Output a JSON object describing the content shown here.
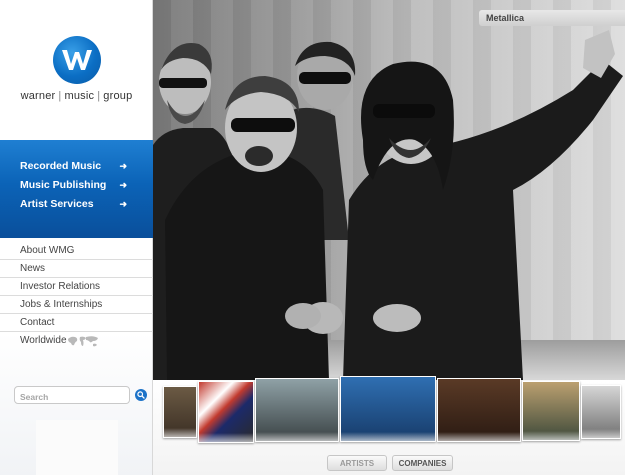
{
  "brand": {
    "words": [
      "warner",
      "music",
      "group"
    ],
    "color": "#0b6ec4"
  },
  "primary_nav": [
    {
      "label": "Recorded Music",
      "icon": "arrow-right-icon"
    },
    {
      "label": "Music Publishing",
      "icon": "arrow-right-icon"
    },
    {
      "label": "Artist Services",
      "icon": "arrow-right-icon"
    }
  ],
  "secondary_nav": [
    {
      "label": "About WMG"
    },
    {
      "label": "News"
    },
    {
      "label": "Investor Relations"
    },
    {
      "label": "Jobs & Internships"
    },
    {
      "label": "Contact"
    },
    {
      "label": "Worldwide",
      "icon": "world-map-icon"
    }
  ],
  "search": {
    "placeholder": "Search",
    "button_icon": "search-icon"
  },
  "hero": {
    "caption": "Metallica"
  },
  "carousel": {
    "tabs": [
      {
        "label": "ARTISTS",
        "state": "inactive"
      },
      {
        "label": "COMPANIES",
        "state": "active"
      }
    ]
  },
  "colors": {
    "nav_blue": "#0b63b7",
    "text_gray": "#444444"
  }
}
